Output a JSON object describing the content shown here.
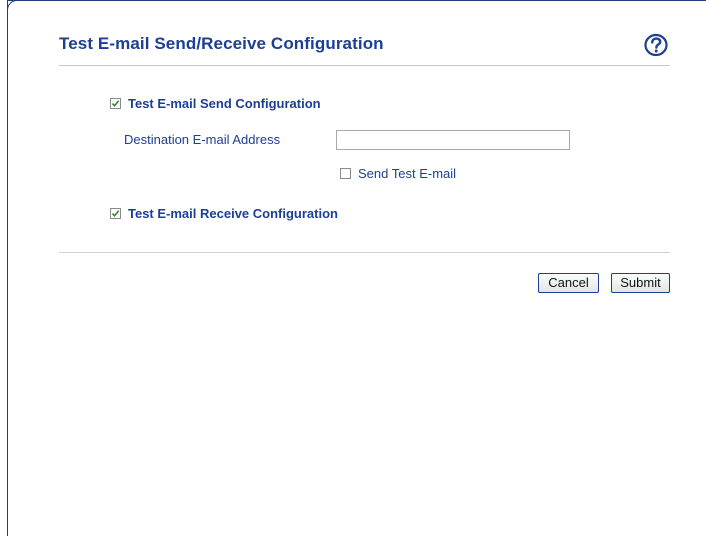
{
  "page": {
    "title": "Test E-mail Send/Receive Configuration"
  },
  "send_config": {
    "label": "Test E-mail Send Configuration",
    "checked": true
  },
  "destination": {
    "label": "Destination E-mail Address",
    "value": "",
    "placeholder": ""
  },
  "send_test": {
    "label": "Send Test E-mail",
    "checked": false
  },
  "receive_config": {
    "label": "Test E-mail Receive Configuration",
    "checked": true
  },
  "buttons": {
    "cancel": "Cancel",
    "submit": "Submit"
  },
  "icons": {
    "help": "help-question-icon",
    "check": "checkmark-icon"
  },
  "colors": {
    "title": "#1c3f94",
    "accent": "#1f3d7a",
    "check": "#2e8b2e"
  }
}
